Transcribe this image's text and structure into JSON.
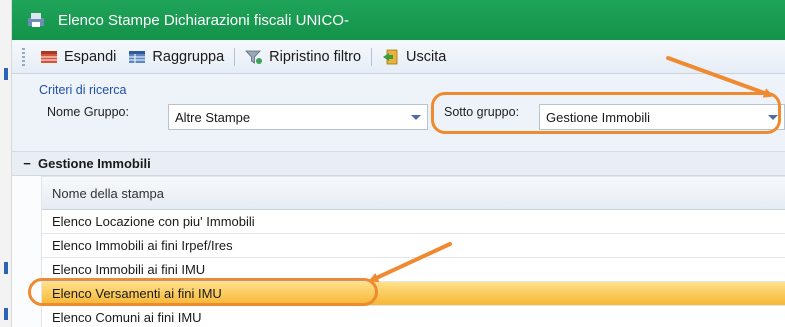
{
  "window": {
    "title": "Elenco Stampe Dichiarazioni fiscali UNICO-"
  },
  "toolbar": {
    "expand_label": "Espandi",
    "group_label": "Raggruppa",
    "reset_filter_label": "Ripristino filtro",
    "exit_label": "Uscita"
  },
  "criteria": {
    "title": "Criteri di ricerca",
    "group_label": "Nome Gruppo:",
    "group_value": "Altre Stampe",
    "subgroup_label": "Sotto gruppo:",
    "subgroup_value": "Gestione Immobili"
  },
  "grid": {
    "group_toggle": "−",
    "group_name": "Gestione Immobili",
    "column_header": "Nome della stampa",
    "rows": [
      "Elenco Locazione con piu' Immobili",
      "Elenco Immobili ai fini Irpef/Ires",
      "Elenco Immobili ai fini IMU",
      "Elenco Versamenti ai fini IMU",
      "Elenco Comuni ai fini IMU"
    ],
    "selected_row": 3
  },
  "colors": {
    "title_bar": "#14924a",
    "highlight": "#f08a30",
    "selected_row": "#f7b733",
    "criteria_title": "#1f4fa8"
  },
  "icons": [
    "app-icon",
    "expand-icon",
    "group-icon",
    "filter-reset-icon",
    "exit-icon",
    "dropdown-arrow-icon"
  ]
}
